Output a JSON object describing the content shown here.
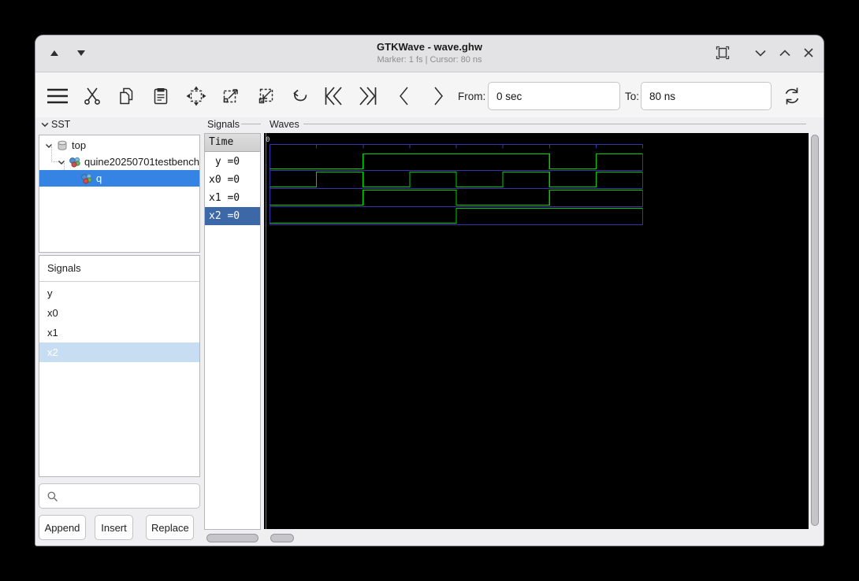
{
  "window": {
    "title": "GTKWave - wave.ghw",
    "subtitle": "Marker: 1 fs  |  Cursor: 80 ns"
  },
  "titlebar_icons": [
    "shift-up-icon",
    "shift-down-icon",
    "fit-window-icon",
    "minimize-icon",
    "maximize-icon",
    "close-icon"
  ],
  "toolbar": {
    "from_label": "From:",
    "from_value": "0 sec",
    "to_label": "To:",
    "to_value": "80 ns",
    "icon_names": [
      "menu-icon",
      "cut-icon",
      "copy-icon",
      "paste-icon",
      "zoom-fit-icon",
      "zoom-in-icon",
      "zoom-out-icon",
      "undo-icon",
      "to-start-icon",
      "to-end-icon",
      "prev-edge-icon",
      "next-edge-icon",
      "reload-icon"
    ]
  },
  "sst": {
    "frame_label": "SST",
    "tree": [
      {
        "label": "top",
        "icon": "component-icon",
        "depth": 0,
        "expanded": true,
        "selected": false
      },
      {
        "label": "quine20250701testbench",
        "icon": "module-icon",
        "depth": 1,
        "expanded": true,
        "selected": false
      },
      {
        "label": "q",
        "icon": "module-icon",
        "depth": 2,
        "expanded": false,
        "selected": true
      }
    ],
    "signals_list": {
      "header": "Signals",
      "items": [
        {
          "label": "y",
          "selected": false
        },
        {
          "label": "x0",
          "selected": false
        },
        {
          "label": "x1",
          "selected": false
        },
        {
          "label": "x2",
          "selected": true
        }
      ]
    },
    "search_value": "",
    "buttons": [
      "Append",
      "Insert",
      "Replace"
    ]
  },
  "values_panel": {
    "frame_label": "Signals",
    "header": "Time",
    "rows": [
      {
        "text": " y =0",
        "selected": false
      },
      {
        "text": "x0 =0",
        "selected": false
      },
      {
        "text": "x1 =0",
        "selected": false
      },
      {
        "text": "x2 =0",
        "selected": true
      }
    ]
  },
  "waves": {
    "frame_label": "Waves",
    "origin_label": "0"
  },
  "chart_data": {
    "type": "digital-waveform",
    "title": "GTKWave trace of wave.ghw",
    "time_unit": "ns",
    "t_start": 0,
    "t_end": 80,
    "tick_interval_ns": 10,
    "slot_width_ns": 10,
    "ruler_labels": [
      "0"
    ],
    "signals": [
      {
        "name": "y",
        "current_value": 0,
        "slots": [
          0,
          0,
          1,
          1,
          1,
          1,
          0,
          1
        ]
      },
      {
        "name": "x0",
        "current_value": 0,
        "slots": [
          0,
          1,
          0,
          1,
          0,
          1,
          0,
          1
        ]
      },
      {
        "name": "x1",
        "current_value": 0,
        "slots": [
          0,
          0,
          1,
          1,
          0,
          0,
          1,
          1
        ]
      },
      {
        "name": "x2",
        "current_value": 0,
        "slots": [
          0,
          0,
          0,
          0,
          1,
          1,
          1,
          1
        ]
      }
    ],
    "marker_time": "1 fs",
    "cursor_time": "80 ns",
    "colors": {
      "background": "#000000",
      "wave": "#00cf00",
      "grid": "#3434ae",
      "marker": "#c74a4a",
      "label": "#dcdcdc"
    }
  },
  "ui_colors": {
    "tree_selection": "#3584e4",
    "list_selection": "#c7ddf2",
    "value_selection": "#3d68a8",
    "titlebar": "#e3e3e5",
    "toolbar": "#f5f5f6"
  }
}
